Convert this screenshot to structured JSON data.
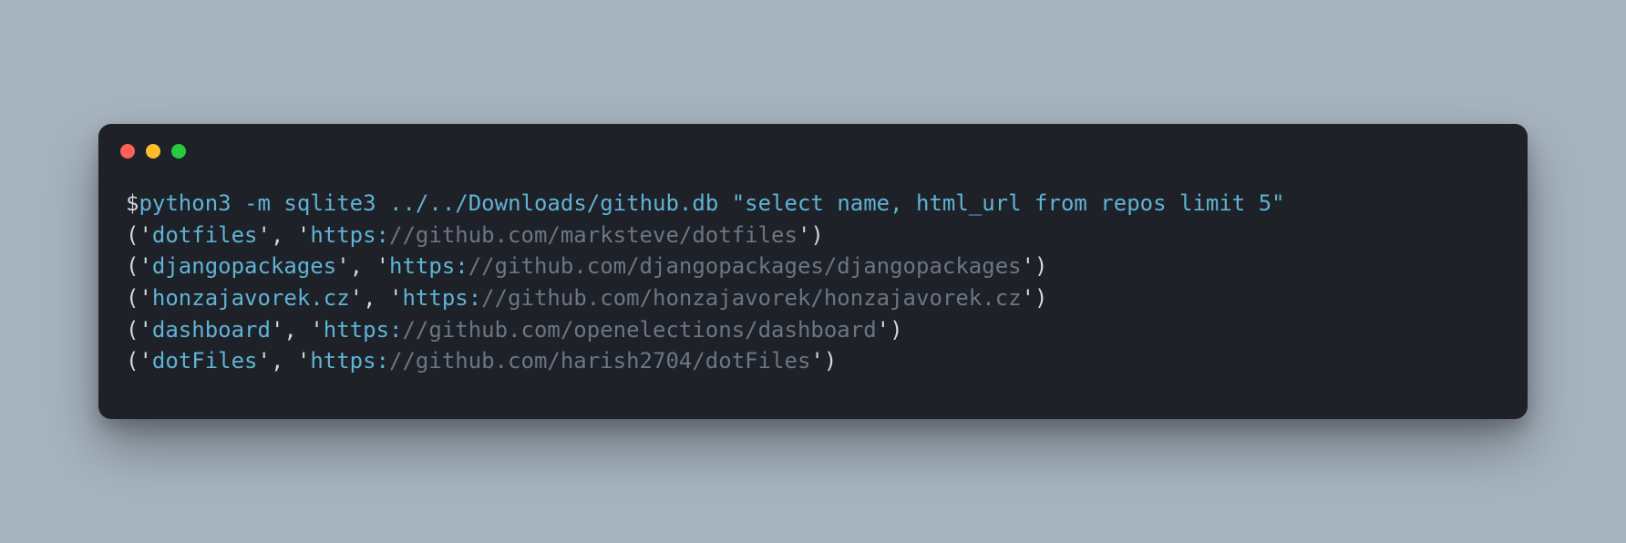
{
  "prompt": {
    "symbol": "$",
    "command": "python3",
    "flag": "-m",
    "module": "sqlite3",
    "dbpath": "../../Downloads/github.db",
    "query": "\"select name, html_url from repos limit 5\""
  },
  "results": [
    {
      "name": "dotfiles",
      "scheme": "https:",
      "rest": "//github.com/marksteve/dotfiles"
    },
    {
      "name": "djangopackages",
      "scheme": "https:",
      "rest": "//github.com/djangopackages/djangopackages"
    },
    {
      "name": "honzajavorek.cz",
      "scheme": "https:",
      "rest": "//github.com/honzajavorek/honzajavorek.cz"
    },
    {
      "name": "dashboard",
      "scheme": "https:",
      "rest": "//github.com/openelections/dashboard"
    },
    {
      "name": "dotFiles",
      "scheme": "https:",
      "rest": "//github.com/harish2704/dotFiles"
    }
  ]
}
